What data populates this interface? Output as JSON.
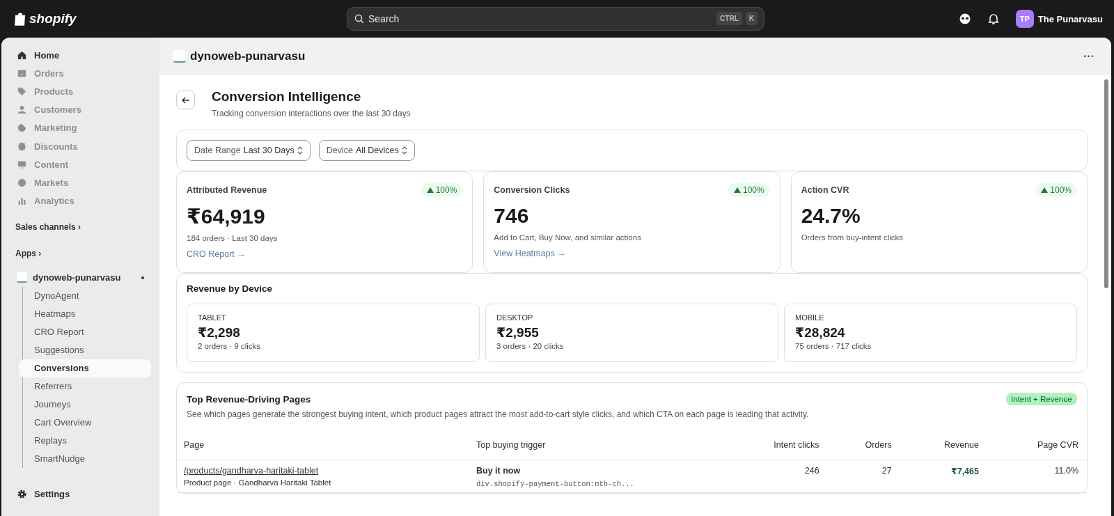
{
  "topbar": {
    "brand": "shopify",
    "search": {
      "placeholder": "Search",
      "keys": [
        "CTRL",
        "K"
      ]
    },
    "user": {
      "initials": "TP",
      "name": "The Punarvasu"
    }
  },
  "sidebar": {
    "items": [
      {
        "label": "Home",
        "disabled": false
      },
      {
        "label": "Orders",
        "disabled": true
      },
      {
        "label": "Products",
        "disabled": true
      },
      {
        "label": "Customers",
        "disabled": true
      },
      {
        "label": "Marketing",
        "disabled": true
      },
      {
        "label": "Discounts",
        "disabled": true
      },
      {
        "label": "Content",
        "disabled": true
      },
      {
        "label": "Markets",
        "disabled": true
      },
      {
        "label": "Analytics",
        "disabled": true
      }
    ],
    "sections": [
      {
        "label": "Sales channels",
        "chevron": "›"
      },
      {
        "label": "Apps",
        "chevron": "›"
      }
    ],
    "app": {
      "label": "dynoweb-punarvasu",
      "pinned": true,
      "children": [
        {
          "label": "DynoAgent",
          "selected": false
        },
        {
          "label": "Heatmaps",
          "selected": false
        },
        {
          "label": "CRO Report",
          "selected": false
        },
        {
          "label": "Suggestions",
          "selected": false
        },
        {
          "label": "Conversions",
          "selected": true
        },
        {
          "label": "Referrers",
          "selected": false
        },
        {
          "label": "Journeys",
          "selected": false
        },
        {
          "label": "Cart Overview",
          "selected": false
        },
        {
          "label": "Replays",
          "selected": false
        },
        {
          "label": "SmartNudge",
          "selected": false
        }
      ]
    },
    "settings": "Settings"
  },
  "app_header": {
    "title": "dynoweb-punarvasu",
    "more": "···"
  },
  "page": {
    "title": "Conversion Intelligence",
    "subtitle": "Tracking conversion interactions over the last 30 days",
    "filters": [
      {
        "label": "Date Range",
        "value": "Last 30 Days"
      },
      {
        "label": "Device",
        "value": "All Devices"
      }
    ],
    "metrics": [
      {
        "title": "Attributed Revenue",
        "change": "100%",
        "value": "₹64,919",
        "note": "184 orders · Last 30 days",
        "link": "CRO Report →"
      },
      {
        "title": "Conversion Clicks",
        "change": "100%",
        "value": "746",
        "note": "Add to Cart, Buy Now, and similar actions",
        "link": "View Heatmaps →"
      },
      {
        "title": "Action CVR",
        "change": "100%",
        "value": "24.7%",
        "note": "Orders from buy-intent clicks"
      }
    ],
    "devices": {
      "title": "Revenue by Device",
      "items": [
        {
          "name": "TABLET",
          "value": "₹2,298",
          "note": "2 orders · 9 clicks"
        },
        {
          "name": "DESKTOP",
          "value": "₹2,955",
          "note": "3 orders · 20 clicks"
        },
        {
          "name": "MOBILE",
          "value": "₹28,824",
          "note": "75 orders · 717 clicks"
        }
      ]
    },
    "top_pages": {
      "title": "Top Revenue-Driving Pages",
      "badge": "Intent + Revenue",
      "description": "See which pages generate the strongest buying intent, which product pages attract the most add-to-cart style clicks, and which CTA on each page is leading that activity.",
      "columns": [
        "Page",
        "Top buying trigger",
        "Intent clicks",
        "Orders",
        "Revenue",
        "Page CVR"
      ],
      "rows": [
        {
          "path": "/products/gandharva-haritaki-tablet",
          "page_info": "Product page · Gandharva Haritaki Tablet",
          "trigger": "Buy it now",
          "selector": "div.shopify-payment-button:nth-ch...",
          "intent_clicks": "246",
          "orders": "27",
          "revenue": "₹7,465",
          "cvr": "11.0%"
        }
      ]
    }
  }
}
